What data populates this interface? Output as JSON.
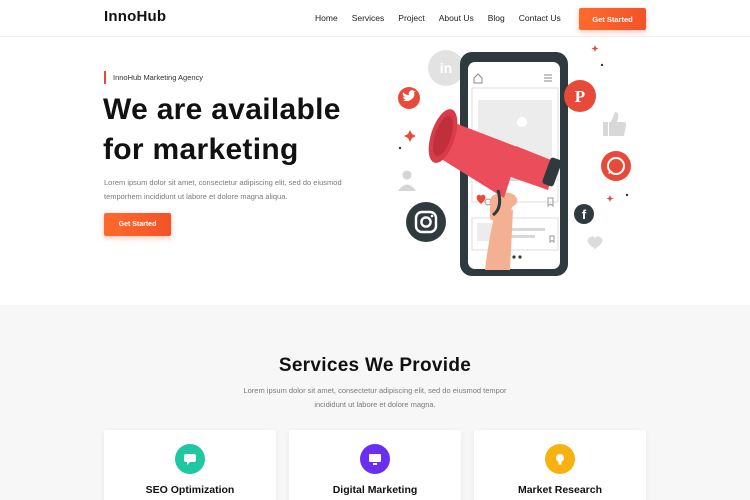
{
  "header": {
    "logo": "InnoHub",
    "nav": [
      "Home",
      "Services",
      "Project",
      "About Us",
      "Blog",
      "Contact Us"
    ],
    "cta": "Get Started"
  },
  "hero": {
    "tagline": "InnoHub Marketing Agency",
    "title_line1": "We are available",
    "title_line2": "for marketing",
    "desc_line1": "Lorem ipsum dolor sit amet, consectetur adipiscing elit, sed do eiusmod",
    "desc_line2": "temporhem incididunt ut labore et dolore magna aliqua.",
    "cta": "Get Started"
  },
  "services": {
    "title": "Services We Provide",
    "desc_line1": "Lorem ipsum dolor sit amet, consectetur adipiscing elit, sed do eiusmod tempor",
    "desc_line2": "incididunt ut labore et dolore magna.",
    "cards": [
      {
        "label": "SEO Optimization",
        "icon": "chat-bubble-icon",
        "color": "#1fc8a0"
      },
      {
        "label": "Digital Marketing",
        "icon": "monitor-icon",
        "color": "#6a2ef0"
      },
      {
        "label": "Market Research",
        "icon": "lightbulb-icon",
        "color": "#f7b20f"
      }
    ]
  },
  "colors": {
    "accent": "#f2532a",
    "tagline_bar": "#e84a3a",
    "megaphone": "#ec4d5a"
  }
}
